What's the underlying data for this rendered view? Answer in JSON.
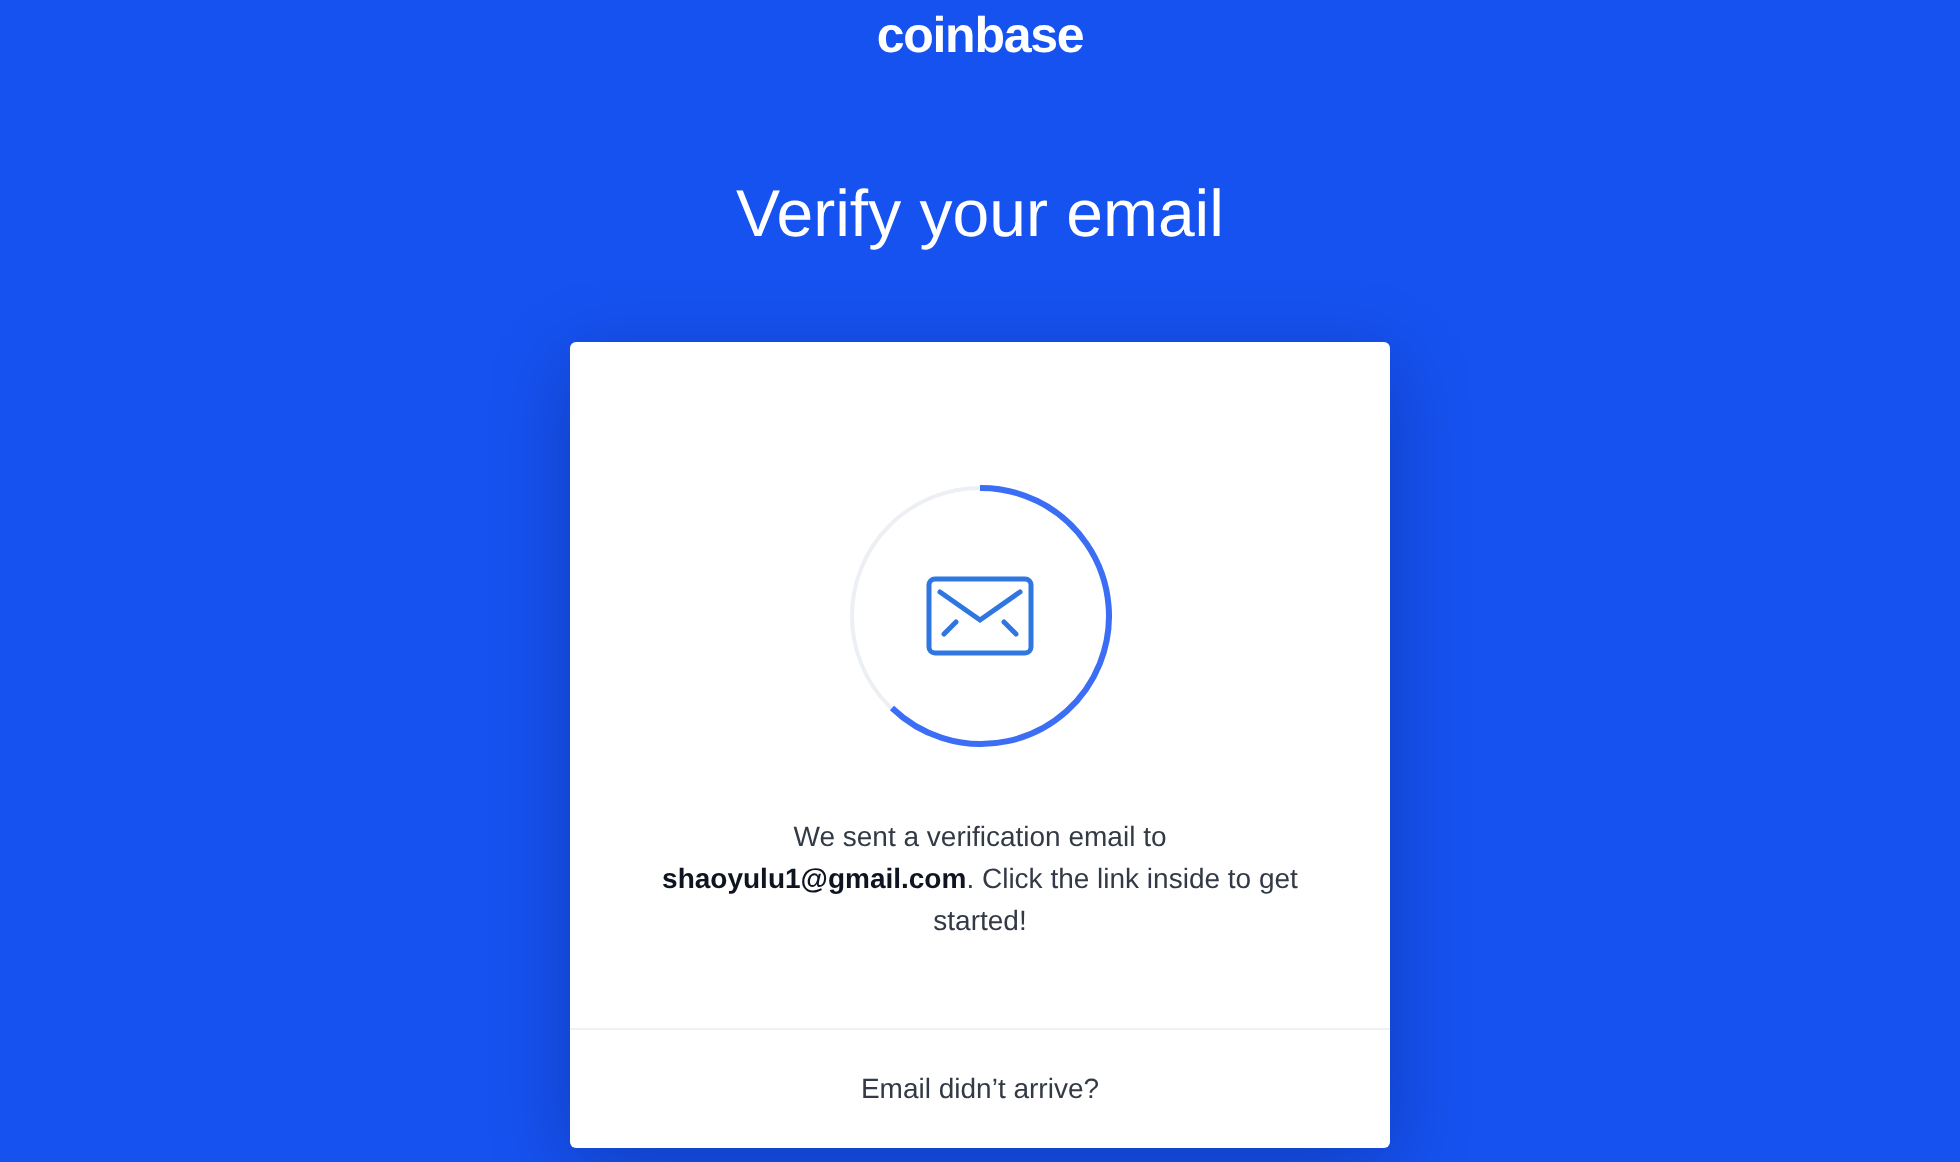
{
  "logo": "coinbase",
  "title": "Verify your email",
  "card": {
    "message": "We sent a verification email to **shaoyulu1@gmail.com**. Click the link inside to get started!",
    "footer_link": "Email didn’t arrive?"
  }
}
